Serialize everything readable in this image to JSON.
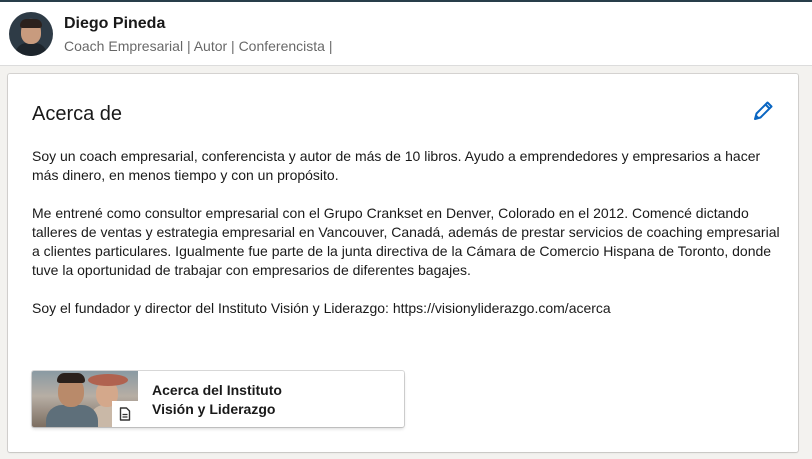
{
  "profile": {
    "name": "Diego Pineda",
    "headline": "Coach Empresarial | Autor | Conferencista |",
    "avatar_icon": "person-photo-avatar"
  },
  "about": {
    "title": "Acerca de",
    "edit_icon": "pencil-icon",
    "paragraphs": [
      "Soy un coach empresarial, conferencista y autor de más de 10 libros. Ayudo a emprendedores y empresarios a hacer más dinero, en menos tiempo y con un propósito.",
      "Me entrené como consultor empresarial con el Grupo Crankset en Denver, Colorado en el 2012. Comencé dictando talleres de ventas y estrategia empresarial en Vancouver, Canadá, además de prestar servicios de coaching empresarial a clientes particulares. Igualmente fue parte de la junta directiva de la Cámara de Comercio Hispana de Toronto, donde tuve la oportunidad de trabajar con empresarios de diferentes bagajes.",
      "Soy el fundador y director del Instituto Visión y Liderazgo: https://visionyliderazgo.com/acerca"
    ],
    "media": {
      "line1": "Acerca del Instituto",
      "line2": "Visión y Liderazgo",
      "thumb_icon": "photo-thumbnail",
      "type_icon": "document-icon"
    }
  },
  "colors": {
    "accent": "#0a66c2",
    "background": "#f3f2ef",
    "card": "#ffffff"
  }
}
